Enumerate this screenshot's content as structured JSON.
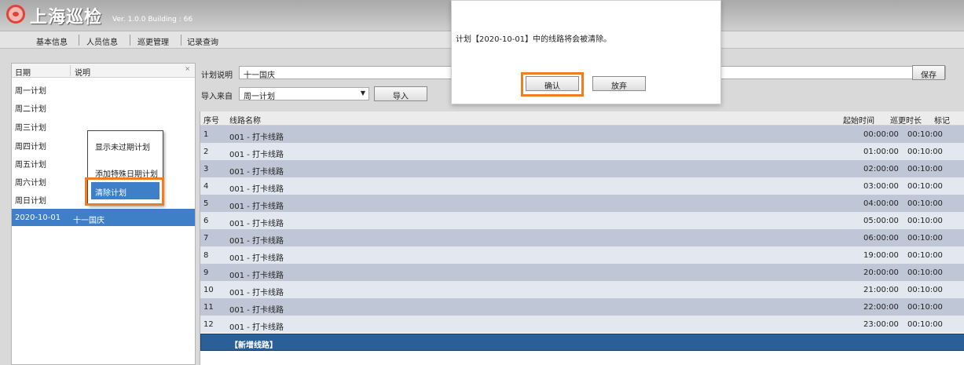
{
  "app": {
    "title": "上海巡检",
    "version": "Ver. 1.0.0 Building : 66"
  },
  "menu": {
    "items": [
      "基本信息",
      "人员信息",
      "巡更管理",
      "记录查询"
    ]
  },
  "left_panel": {
    "col_date": "日期",
    "col_desc": "说明",
    "close_glyph": "×",
    "plans": [
      {
        "date": "周一计划",
        "desc": ""
      },
      {
        "date": "周二计划",
        "desc": ""
      },
      {
        "date": "周三计划",
        "desc": ""
      },
      {
        "date": "周四计划",
        "desc": ""
      },
      {
        "date": "周五计划",
        "desc": ""
      },
      {
        "date": "周六计划",
        "desc": ""
      },
      {
        "date": "周日计划",
        "desc": ""
      },
      {
        "date": "2020-10-01",
        "desc": "十一国庆"
      }
    ]
  },
  "context_menu": {
    "items": [
      "显示未过期计划",
      "添加特殊日期计划",
      "清除计划"
    ]
  },
  "plan_form": {
    "desc_label": "计划说明",
    "desc_value": "十一国庆",
    "save_label": "保存",
    "import_from_label": "导入来自",
    "import_select_value": "周一计划",
    "import_button_label": "导入"
  },
  "grid": {
    "headers": {
      "seq": "序号",
      "route": "线路名称",
      "start": "起始时间",
      "duration": "巡更时长",
      "mark": "标记"
    },
    "rows": [
      {
        "seq": "1",
        "route": "001 - 打卡线路",
        "start": "00:00:00",
        "duration": "00:10:00"
      },
      {
        "seq": "2",
        "route": "001 - 打卡线路",
        "start": "01:00:00",
        "duration": "00:10:00"
      },
      {
        "seq": "3",
        "route": "001 - 打卡线路",
        "start": "02:00:00",
        "duration": "00:10:00"
      },
      {
        "seq": "4",
        "route": "001 - 打卡线路",
        "start": "03:00:00",
        "duration": "00:10:00"
      },
      {
        "seq": "5",
        "route": "001 - 打卡线路",
        "start": "04:00:00",
        "duration": "00:10:00"
      },
      {
        "seq": "6",
        "route": "001 - 打卡线路",
        "start": "05:00:00",
        "duration": "00:10:00"
      },
      {
        "seq": "7",
        "route": "001 - 打卡线路",
        "start": "06:00:00",
        "duration": "00:10:00"
      },
      {
        "seq": "8",
        "route": "001 - 打卡线路",
        "start": "19:00:00",
        "duration": "00:10:00"
      },
      {
        "seq": "9",
        "route": "001 - 打卡线路",
        "start": "20:00:00",
        "duration": "00:10:00"
      },
      {
        "seq": "10",
        "route": "001 - 打卡线路",
        "start": "21:00:00",
        "duration": "00:10:00"
      },
      {
        "seq": "11",
        "route": "001 - 打卡线路",
        "start": "22:00:00",
        "duration": "00:10:00"
      },
      {
        "seq": "12",
        "route": "001 - 打卡线路",
        "start": "23:00:00",
        "duration": "00:10:00"
      }
    ],
    "new_row_label": "【新增线路】"
  },
  "dialog": {
    "message": "计划【2020-10-01】中的线路将会被清除。",
    "confirm_label": "确认",
    "cancel_label": "放弃"
  },
  "colors": {
    "accent": "#3e7fc8",
    "highlight_frame": "#ef7d22",
    "row_dark": "#bfc7d6",
    "row_light": "#e3e7ef",
    "new_row": "#2a5f98"
  }
}
